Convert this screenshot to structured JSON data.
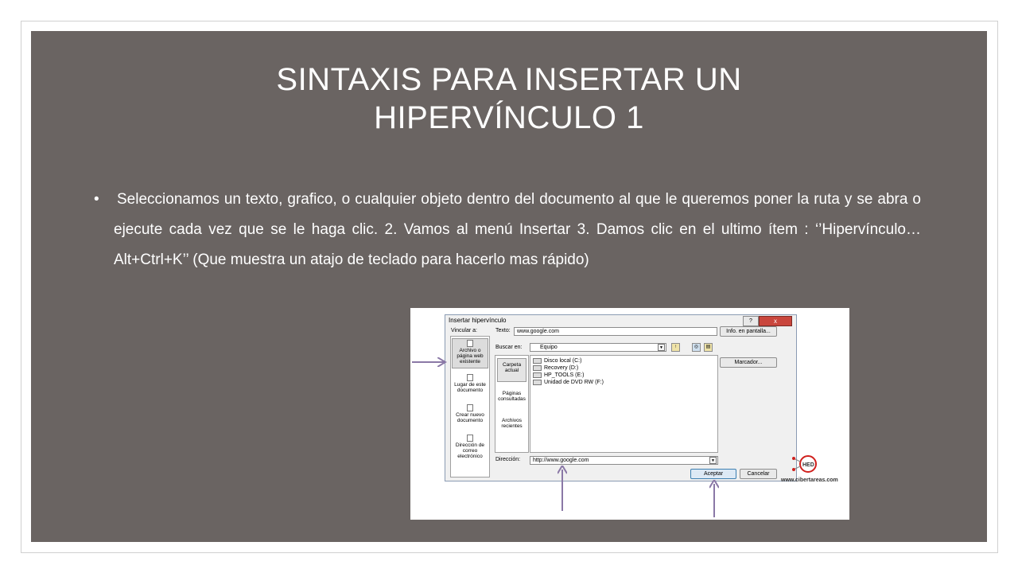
{
  "slide": {
    "title_line1": "SINTAXIS PARA INSERTAR UN",
    "title_line2": "HIPERVÍNCULO 1",
    "bullet": "•",
    "body": "Seleccionamos un texto, grafico, o cualquier objeto dentro del documento al que le queremos poner la ruta y se abra o ejecute cada vez que se le haga clic. 2. Vamos al menú Insertar 3. Damos clic en el ultimo ítem : ‘’Hipervínculo…Alt+Ctrl+K’’ (Que muestra un atajo de teclado para hacerlo mas rápido)"
  },
  "dialog": {
    "title": "Insertar hipervínculo",
    "help": "?",
    "close": "x",
    "vincular_label": "Vincular a:",
    "texto_label": "Texto:",
    "texto_value": "www.google.com",
    "info_button": "Info. en pantalla...",
    "buscar_label": "Buscar en:",
    "buscar_value": "Equipo",
    "marcador_button": "Marcador...",
    "left_items": [
      {
        "l1": "Archivo o",
        "l2": "página web",
        "l3": "existente"
      },
      {
        "l1": "Lugar de este",
        "l2": "documento",
        "l3": ""
      },
      {
        "l1": "Crear nuevo",
        "l2": "documento",
        "l3": ""
      },
      {
        "l1": "Dirección de",
        "l2": "correo",
        "l3": "electrónico"
      }
    ],
    "mid_items": [
      {
        "l1": "Carpeta",
        "l2": "actual"
      },
      {
        "l1": "Páginas",
        "l2": "consultadas"
      },
      {
        "l1": "Archivos",
        "l2": "recientes"
      }
    ],
    "files": [
      "Disco local (C:)",
      "Recovery (D:)",
      "HP_TOOLS (E:)",
      "Unidad de DVD RW (F:)"
    ],
    "direccion_label": "Dirección:",
    "direccion_value": "http://www.google.com",
    "aceptar": "Aceptar",
    "cancelar": "Cancelar"
  },
  "watermark": {
    "logo_text": "HED",
    "site": "www.cibertareas.com"
  },
  "colors": {
    "slide_bg": "#6a6462",
    "arrow": "#8a78a6",
    "text": "#ffffff"
  }
}
